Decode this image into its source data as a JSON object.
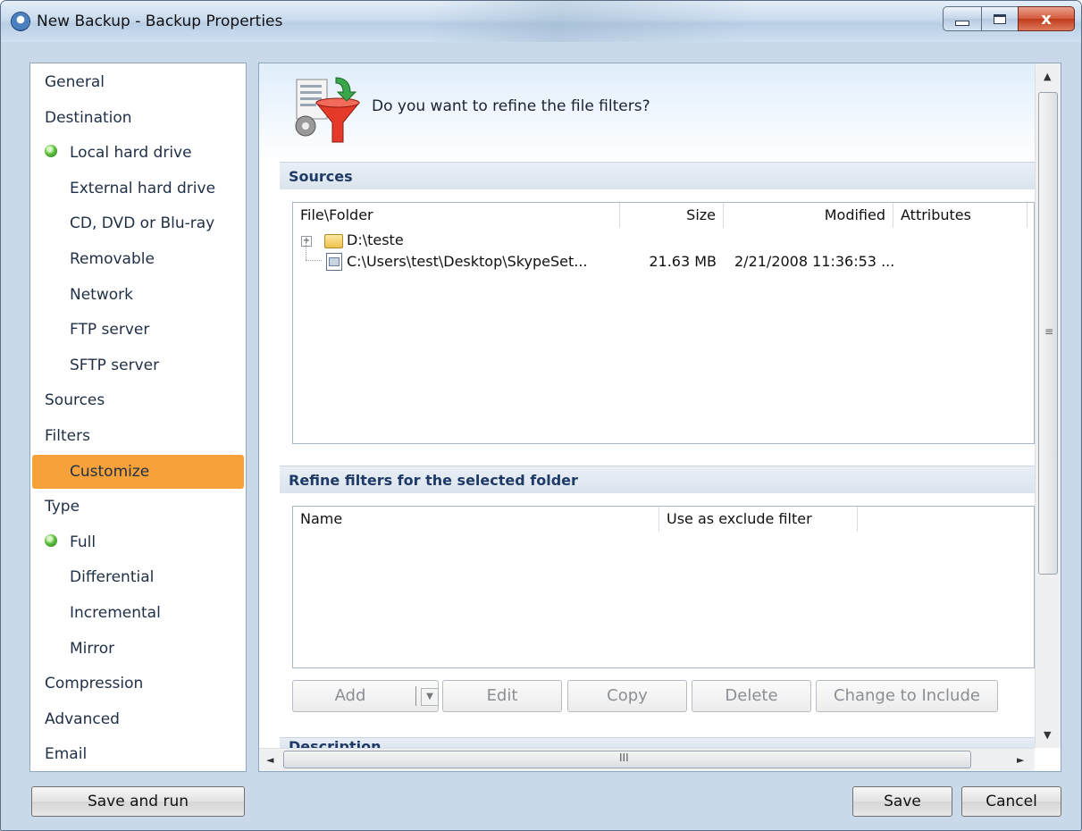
{
  "window": {
    "title": "New Backup - Backup Properties",
    "controls": {
      "minimize": "minimize-icon",
      "maximize": "maximize-icon",
      "close": "x"
    }
  },
  "sidebar": {
    "items": [
      {
        "label": "General",
        "level": 1
      },
      {
        "label": "Destination",
        "level": 1
      },
      {
        "label": "Local hard drive",
        "level": 2,
        "bullet": true
      },
      {
        "label": "External hard drive",
        "level": 2
      },
      {
        "label": "CD, DVD or Blu-ray",
        "level": 2
      },
      {
        "label": "Removable",
        "level": 2
      },
      {
        "label": "Network",
        "level": 2
      },
      {
        "label": "FTP server",
        "level": 2
      },
      {
        "label": "SFTP server",
        "level": 2
      },
      {
        "label": "Sources",
        "level": 1
      },
      {
        "label": "Filters",
        "level": 1
      },
      {
        "label": "Customize",
        "level": 2,
        "selected": true
      },
      {
        "label": "Type",
        "level": 1
      },
      {
        "label": "Full",
        "level": 2,
        "bullet": true
      },
      {
        "label": "Differential",
        "level": 2
      },
      {
        "label": "Incremental",
        "level": 2
      },
      {
        "label": "Mirror",
        "level": 2
      },
      {
        "label": "Compression",
        "level": 1
      },
      {
        "label": "Advanced",
        "level": 1
      },
      {
        "label": "Email",
        "level": 1
      }
    ],
    "selected_color": "#f7a13a"
  },
  "main": {
    "question": "Do you want to refine the file filters?",
    "sources": {
      "title": "Sources",
      "columns": [
        "File\\Folder",
        "Size",
        "Modified",
        "Attributes"
      ],
      "rows": [
        {
          "name": "D:\\teste",
          "size": "",
          "modified": "",
          "attributes": "",
          "icon": "folder-icon",
          "expander": "+"
        },
        {
          "name": "C:\\Users\\test\\Desktop\\SkypeSet...",
          "size": "21.63 MB",
          "modified": "2/21/2008 11:36:53 ...",
          "attributes": "",
          "icon": "file-icon"
        }
      ]
    },
    "refine": {
      "title": "Refine filters for the selected folder",
      "columns": [
        "Name",
        "Use as exclude filter"
      ]
    },
    "buttons": {
      "add": "Add",
      "edit": "Edit",
      "copy": "Copy",
      "delete": "Delete",
      "change": "Change to Include"
    },
    "description_title": "Description"
  },
  "scrollbars": {
    "v_grip": "≡",
    "h_grip": "III"
  },
  "footer": {
    "save_and_run": "Save and run",
    "save": "Save",
    "cancel": "Cancel"
  },
  "colors": {
    "accent": "#f7a13a",
    "section_title": "#1f3a66",
    "close_button": "#c03a1b"
  }
}
